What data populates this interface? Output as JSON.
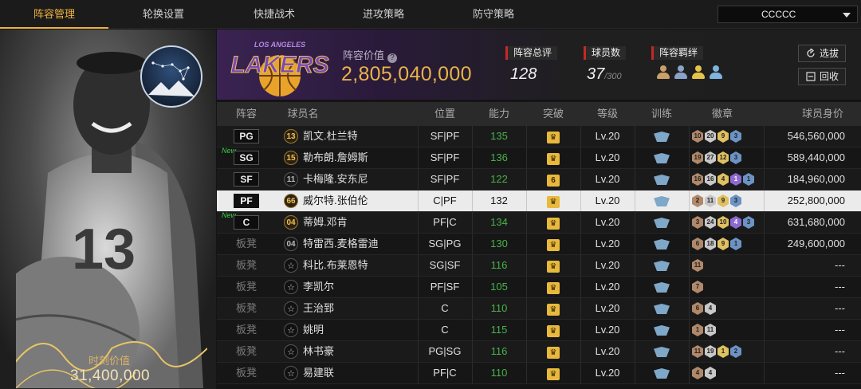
{
  "tabs": [
    {
      "label": "阵容管理",
      "active": true
    },
    {
      "label": "轮换设置",
      "active": false
    },
    {
      "label": "快捷战术",
      "active": false
    },
    {
      "label": "进攻策略",
      "active": false
    },
    {
      "label": "防守策略",
      "active": false
    }
  ],
  "dropdown": {
    "value": "CCCCC"
  },
  "card": {
    "value_label": "时刻价值",
    "value": "31,400,000",
    "jersey_number": "13",
    "constellation_icon": "constellation-icon"
  },
  "header": {
    "team_logo": "lakers-logo",
    "team_logo_text": "LAKERS",
    "team_logo_subtext": "LOS ANGELES",
    "lineup_value_label": "阵容价值",
    "lineup_value": "2,805,040,000",
    "overall_label": "阵容总评",
    "overall_value": "128",
    "player_count_label": "球员数",
    "player_count_value": "37",
    "player_count_max": "/300",
    "bonds_label": "阵容羁绊",
    "bond_colors": [
      "#c9a06a",
      "#8aa3c7",
      "#e6c34a",
      "#7fb3e0"
    ],
    "draft_button": "选拔",
    "recycle_button": "回收"
  },
  "columns": [
    "阵容",
    "球员名",
    "位置",
    "能力",
    "突破",
    "等级",
    "训练",
    "徽章",
    "球员身价"
  ],
  "rows": [
    {
      "slot": "PG",
      "starter": true,
      "new": false,
      "jersey": "13",
      "jersey_style": "gold",
      "name": "凯文.杜兰特",
      "position": "SF|PF",
      "ability": "135",
      "breakthrough": "♛",
      "level": "Lv.20",
      "badges": [
        [
          "bronze",
          "10"
        ],
        [
          "silver",
          "20"
        ],
        [
          "gold",
          "9"
        ],
        [
          "blue",
          "3"
        ]
      ],
      "value": "546,560,000",
      "selected": false
    },
    {
      "slot": "SG",
      "starter": true,
      "new": true,
      "jersey": "15",
      "jersey_style": "gold",
      "name": "勒布朗.詹姆斯",
      "position": "SF|PF",
      "ability": "136",
      "breakthrough": "♛",
      "level": "Lv.20",
      "badges": [
        [
          "bronze",
          "19"
        ],
        [
          "silver",
          "27"
        ],
        [
          "gold",
          "12"
        ],
        [
          "blue",
          "3"
        ]
      ],
      "value": "589,440,000",
      "selected": false
    },
    {
      "slot": "SF",
      "starter": true,
      "new": false,
      "jersey": "11",
      "jersey_style": "plain",
      "name": "卡梅隆.安东尼",
      "position": "SF|PF",
      "ability": "122",
      "breakthrough": "6",
      "level": "Lv.20",
      "badges": [
        [
          "bronze",
          "16"
        ],
        [
          "silver",
          "16"
        ],
        [
          "gold",
          "4"
        ],
        [
          "purple",
          "1"
        ],
        [
          "blue",
          "1"
        ]
      ],
      "value": "184,960,000",
      "selected": false
    },
    {
      "slot": "PF",
      "starter": true,
      "new": false,
      "jersey": "66",
      "jersey_style": "gold",
      "name": "威尔特.张伯伦",
      "position": "C|PF",
      "ability": "132",
      "breakthrough": "♛",
      "level": "Lv.20",
      "badges": [
        [
          "bronze",
          "2"
        ],
        [
          "silver",
          "11"
        ],
        [
          "gold",
          "9"
        ],
        [
          "blue",
          "3"
        ]
      ],
      "value": "252,800,000",
      "selected": true
    },
    {
      "slot": "C",
      "starter": true,
      "new": true,
      "jersey": "04",
      "jersey_style": "gold",
      "name": "蒂姆.邓肯",
      "position": "PF|C",
      "ability": "134",
      "breakthrough": "♛",
      "level": "Lv.20",
      "badges": [
        [
          "bronze",
          "3"
        ],
        [
          "silver",
          "24"
        ],
        [
          "gold",
          "10"
        ],
        [
          "purple",
          "4"
        ],
        [
          "blue",
          "3"
        ]
      ],
      "value": "631,680,000",
      "selected": false
    },
    {
      "slot": "板凳",
      "starter": false,
      "new": false,
      "jersey": "04",
      "jersey_style": "plain",
      "name": "特雷西.麦格雷迪",
      "position": "SG|PG",
      "ability": "130",
      "breakthrough": "♛",
      "level": "Lv.20",
      "badges": [
        [
          "bronze",
          "6"
        ],
        [
          "silver",
          "18"
        ],
        [
          "gold",
          "9"
        ],
        [
          "blue",
          "1"
        ]
      ],
      "value": "249,600,000",
      "selected": false
    },
    {
      "slot": "板凳",
      "starter": false,
      "new": false,
      "jersey": "☆",
      "jersey_style": "star",
      "name": "科比.布莱恩特",
      "position": "SG|SF",
      "ability": "116",
      "breakthrough": "♛",
      "level": "Lv.20",
      "badges": [
        [
          "bronze",
          "11"
        ]
      ],
      "value": "---",
      "selected": false
    },
    {
      "slot": "板凳",
      "starter": false,
      "new": false,
      "jersey": "☆",
      "jersey_style": "star",
      "name": "李凯尔",
      "position": "PF|SF",
      "ability": "105",
      "breakthrough": "♛",
      "level": "Lv.20",
      "badges": [
        [
          "bronze",
          "7"
        ]
      ],
      "value": "---",
      "selected": false
    },
    {
      "slot": "板凳",
      "starter": false,
      "new": false,
      "jersey": "☆",
      "jersey_style": "star",
      "name": "王治郅",
      "position": "C",
      "ability": "110",
      "breakthrough": "♛",
      "level": "Lv.20",
      "badges": [
        [
          "bronze",
          "6"
        ],
        [
          "silver",
          "4"
        ]
      ],
      "value": "---",
      "selected": false
    },
    {
      "slot": "板凳",
      "starter": false,
      "new": false,
      "jersey": "☆",
      "jersey_style": "star",
      "name": "姚明",
      "position": "C",
      "ability": "115",
      "breakthrough": "♛",
      "level": "Lv.20",
      "badges": [
        [
          "bronze",
          "1"
        ],
        [
          "silver",
          "11"
        ]
      ],
      "value": "---",
      "selected": false
    },
    {
      "slot": "板凳",
      "starter": false,
      "new": false,
      "jersey": "☆",
      "jersey_style": "star",
      "name": "林书豪",
      "position": "PG|SG",
      "ability": "116",
      "breakthrough": "♛",
      "level": "Lv.20",
      "badges": [
        [
          "bronze",
          "11"
        ],
        [
          "silver",
          "19"
        ],
        [
          "gold",
          "1"
        ],
        [
          "blue",
          "2"
        ]
      ],
      "value": "---",
      "selected": false
    },
    {
      "slot": "板凳",
      "starter": false,
      "new": false,
      "jersey": "☆",
      "jersey_style": "star",
      "name": "易建联",
      "position": "PF|C",
      "ability": "110",
      "breakthrough": "♛",
      "level": "Lv.20",
      "badges": [
        [
          "bronze",
          "4"
        ],
        [
          "silver",
          "4"
        ]
      ],
      "value": "---",
      "selected": false
    }
  ],
  "new_tag": "New"
}
